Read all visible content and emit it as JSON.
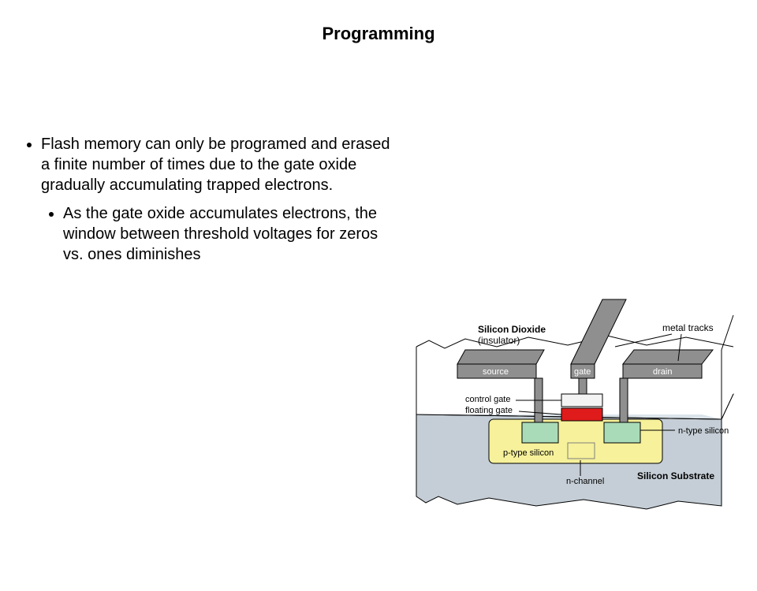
{
  "title": "Programming",
  "bullets": {
    "main": "Flash memory can only be programed and erased a finite number of times due to the gate oxide gradually accumulating trapped electrons.",
    "sub": "As the gate oxide accumulates electrons, the window between threshold voltages for zeros vs. ones diminishes"
  },
  "diagram": {
    "silicon_dioxide": "Silicon Dioxide",
    "insulator": "(insulator)",
    "metal_tracks": "metal tracks",
    "source": "source",
    "gate": "gate",
    "drain": "drain",
    "control_gate": "control gate",
    "floating_gate": "floating gate",
    "p_type_silicon": "p-type silicon",
    "n_type_silicon": "n-type silicon",
    "n_channel": "n-channel",
    "silicon_substrate": "Silicon Substrate"
  }
}
